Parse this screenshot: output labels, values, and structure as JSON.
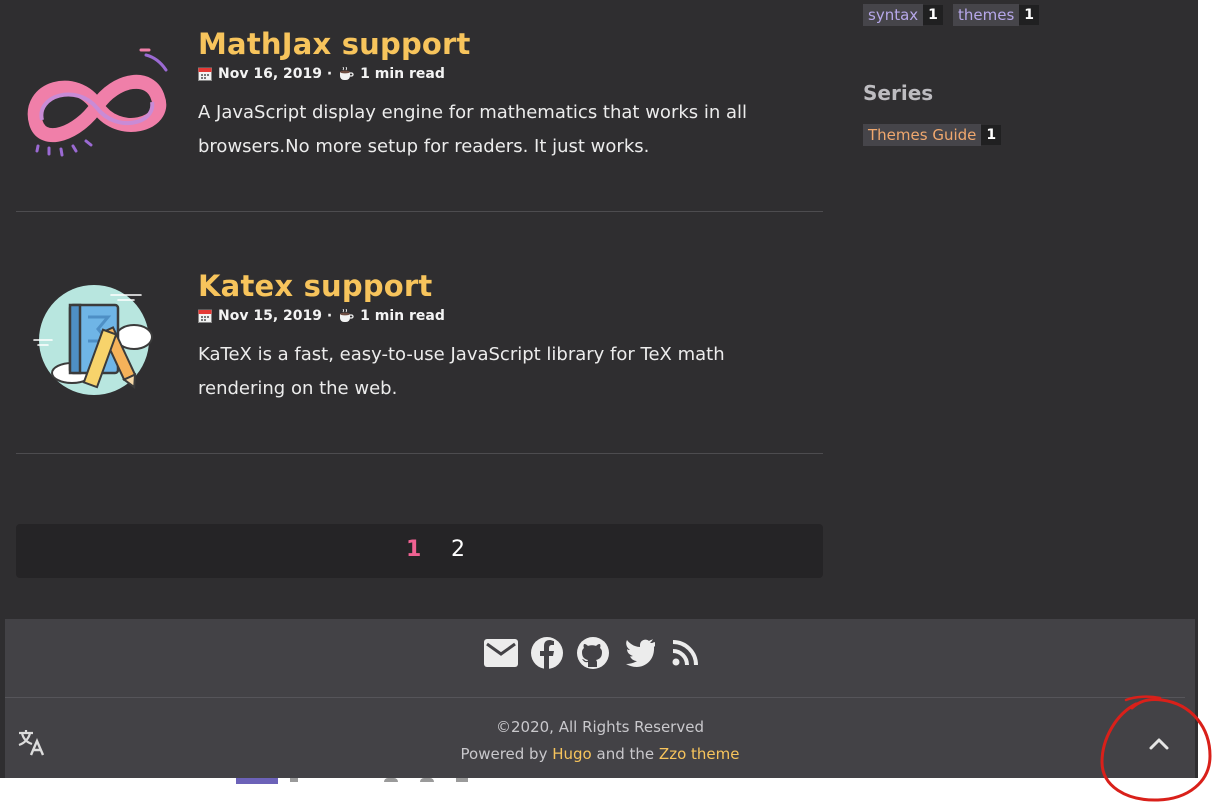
{
  "posts": [
    {
      "title": "MathJax support",
      "date": "Nov 16, 2019 ·",
      "read_time": "1 min read",
      "summary": "A JavaScript display engine for mathematics that works in all browsers.No more setup for readers. It just works."
    },
    {
      "title": "Katex support",
      "date": "Nov 15, 2019 ·",
      "read_time": "1 min read",
      "summary": "KaTeX is a fast, easy-to-use JavaScript library for TeX math rendering on the web."
    }
  ],
  "pagination": {
    "current": "1",
    "next": "2"
  },
  "sidebar": {
    "tags": [
      {
        "name": "syntax",
        "count": "1"
      },
      {
        "name": "themes",
        "count": "1"
      }
    ],
    "series_heading": "Series",
    "series": [
      {
        "name": "Themes Guide",
        "count": "1"
      }
    ]
  },
  "footer": {
    "social_icons": [
      "email-icon",
      "facebook-icon",
      "github-icon",
      "twitter-icon",
      "rss-icon"
    ],
    "copyright": "©2020, All Rights Reserved",
    "powered_prefix": "Powered by",
    "hugo_link": "Hugo",
    "powered_middle": "and the",
    "theme_link": "Zzo theme"
  },
  "colors": {
    "title": "#f7c45c",
    "background": "#2f2e30",
    "footer": "#434246",
    "pager_active": "#f06292",
    "annotation": "#d9201a"
  }
}
